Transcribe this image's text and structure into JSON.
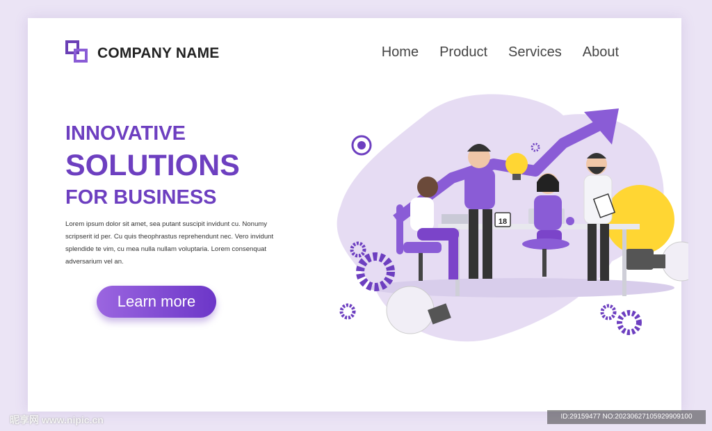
{
  "brand": {
    "name": "COMPANY NAME",
    "logo_icon": "overlapping-squares-icon"
  },
  "nav": {
    "items": [
      {
        "label": "Home"
      },
      {
        "label": "Product"
      },
      {
        "label": "Services"
      },
      {
        "label": "About"
      }
    ]
  },
  "hero": {
    "line1": "INNOVATIVE",
    "line2": "SOLUTIONS",
    "line3": "FOR BUSINESS",
    "paragraph": "Lorem ipsum dolor sit amet, sea putant suscipit invidunt cu. Nonumy scripserit id per. Cu quis theophrastus reprehendunt nec. Vero invidunt splendide te vim, cu mea nulla nullam voluptaria. Lorem consenquat adversarium vel an.",
    "cta_label": "Learn more"
  },
  "illustration": {
    "calendar_day": "18"
  },
  "watermark": {
    "left": "昵享网 www.nipic.cn",
    "right": "ID:29159477 NO:20230627105929909100"
  },
  "colors": {
    "accent": "#6d3fc0",
    "accent_light": "#9b66e0",
    "blob": "#e6dcf3",
    "bulb": "#ffd633"
  }
}
